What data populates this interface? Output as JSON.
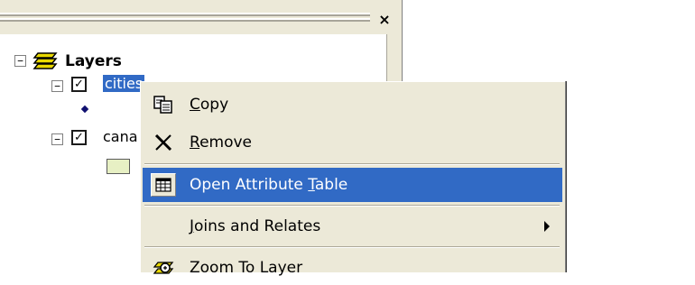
{
  "toc": {
    "close_symbol": "×",
    "root": {
      "label": "Layers",
      "expander": "−",
      "icon": "layers-stack-icon"
    },
    "layers": [
      {
        "name": "cities",
        "checked": true,
        "expander": "−",
        "symbol": "point-diamond",
        "symbol_color": "#101070",
        "selected": true
      },
      {
        "name": "cana",
        "checked": true,
        "expander": "−",
        "symbol": "polygon-fill",
        "symbol_color": "#e7f0c4"
      }
    ]
  },
  "context_menu": {
    "items": [
      {
        "id": "copy",
        "mnemonic": "C",
        "rest": "opy",
        "icon": "copy-icon"
      },
      {
        "id": "remove",
        "mnemonic": "R",
        "rest": "emove",
        "icon": "remove-x-icon"
      },
      {
        "id": "open_attribute_table",
        "prefix": "Open Attribute ",
        "mnemonic": "T",
        "rest": "able",
        "icon": "table-icon",
        "highlighted": true
      },
      {
        "id": "joins_and_relates",
        "mnemonic": "J",
        "rest": "oins and Relates",
        "has_submenu": true
      },
      {
        "id": "zoom_to_layer",
        "label": "Zoom To Layer",
        "icon": "zoom-to-layer-icon"
      }
    ]
  },
  "colors": {
    "selection": "#316ac5",
    "chrome": "#ece9d8",
    "layers_icon": "#e8d800"
  }
}
